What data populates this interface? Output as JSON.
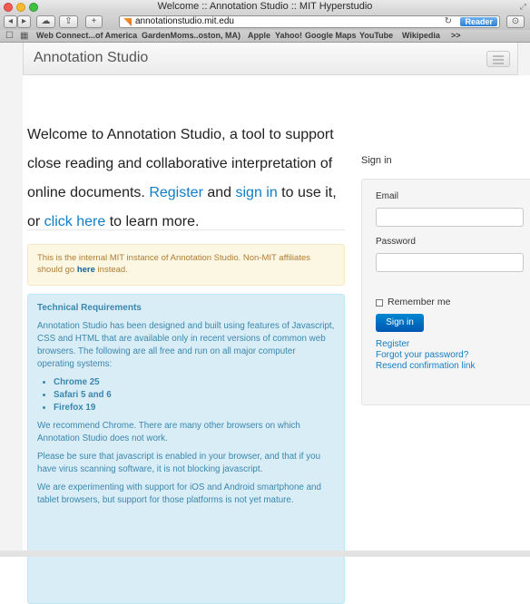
{
  "browser": {
    "window_title": "Welcome :: Annotation Studio :: MIT Hyperstudio",
    "url": "annotationstudio.mit.edu",
    "reader_label": "Reader",
    "nav_icons": [
      "back-arrow",
      "forward-arrow",
      "cloud-icon",
      "share-icon",
      "plus-icon"
    ],
    "bookmarks": [
      "Web Connect...",
      "of America",
      "GardenMoms",
      "...oston, MA)",
      "Apple",
      "Yahoo!",
      "Google Maps",
      "YouTube",
      "Wikipedia",
      ">>"
    ]
  },
  "navbar": {
    "brand": "Annotation Studio"
  },
  "welcome": {
    "part1": "Welcome to Annotation Studio, a tool to support close reading and collaborative interpretation of online documents. ",
    "register": "Register",
    "and": " and ",
    "signin": "sign in",
    "to_use": " to use it, or ",
    "click_here": "click here",
    "learn": " to learn more."
  },
  "alert": {
    "text": "This is the internal MIT instance of Annotation Studio. Non-MIT affiliates should go ",
    "here": "here",
    "tail": " instead."
  },
  "tech": {
    "title": "Technical Requirements",
    "p1": "Annotation Studio has been designed and built using features of Javascript, CSS and HTML that are available only in recent versions of common web browsers. The following are all free and run on all major computer operating systems:",
    "browsers": [
      "Chrome 25",
      "Safari 5 and 6",
      "Firefox 19"
    ],
    "p2": "We recommend Chrome. There are many other browsers on which Annotation Studio does not work.",
    "p3": "Please be sure that javascript is enabled in your browser, and that if you have virus scanning software, it is not blocking javascript.",
    "p4": "We are experimenting with support for iOS and Android smartphone and tablet browsers, but support for those platforms is not yet mature."
  },
  "signin": {
    "title": "Sign in",
    "email_label": "Email",
    "email_value": "",
    "password_label": "Password",
    "password_value": "",
    "remember_label": "Remember me",
    "remember_checked": false,
    "button": "Sign in",
    "links": [
      "Register",
      "Forgot your password?",
      "Resend confirmation link"
    ]
  },
  "colors": {
    "link": "#0f7ec6",
    "button": "#0069c0",
    "alert_bg": "#fcf7e3",
    "info_bg": "#d9edf7"
  }
}
